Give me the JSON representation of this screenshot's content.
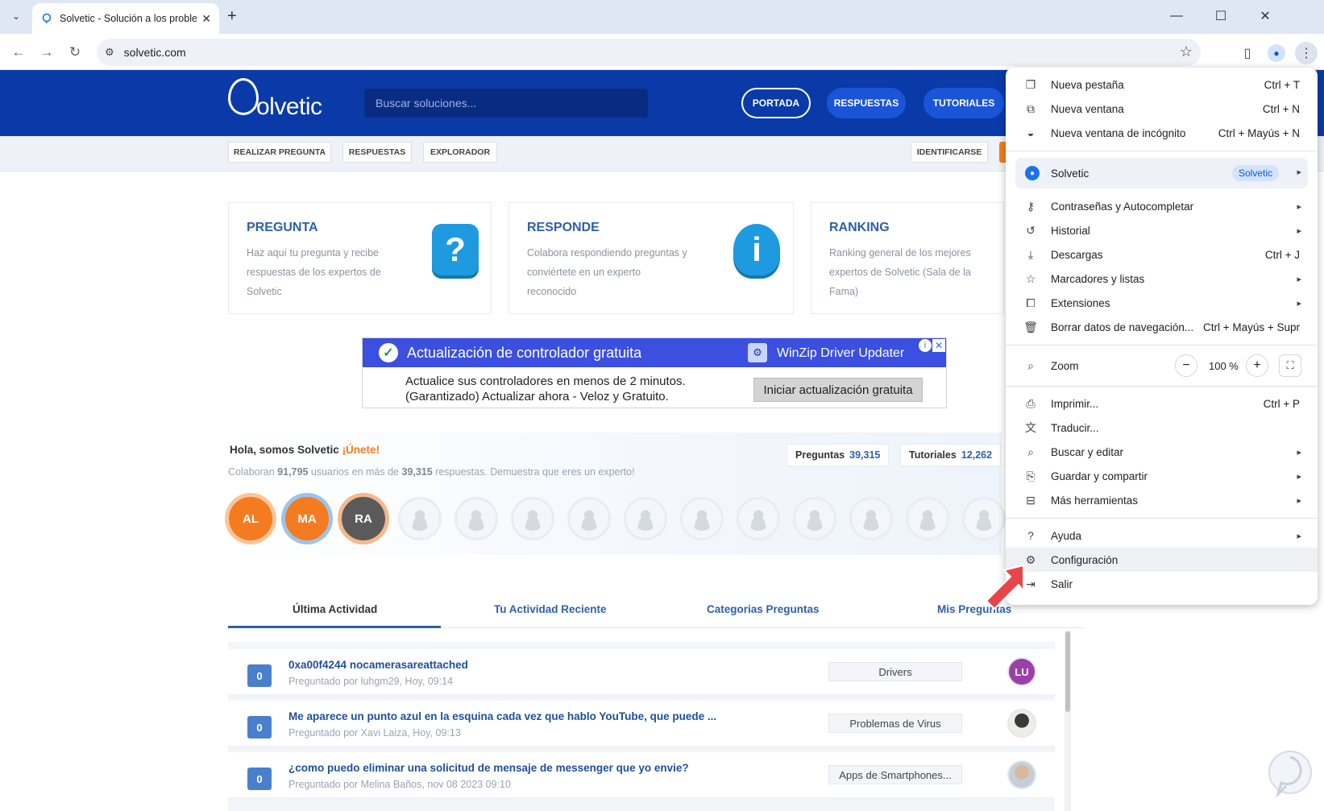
{
  "browser": {
    "tab_title": "Solvetic - Solución a los problemas",
    "url": "solvetic.com",
    "new_tab_symbol": "+",
    "window_controls": [
      "—",
      "☐",
      "✕"
    ]
  },
  "site": {
    "logo_text": "olvetic",
    "search_placeholder": "Buscar soluciones...",
    "nav": [
      "PORTADA",
      "RESPUESTAS",
      "TUTORIALES"
    ],
    "subnav": [
      "REALIZAR PREGUNTA",
      "RESPUESTAS",
      "EXPLORADOR"
    ],
    "login": "IDENTIFICARSE"
  },
  "cards": [
    {
      "title": "PREGUNTA",
      "desc": "Haz aquí tu pregunta y recibe respuestas de los expertos de Solvetic",
      "icon": "?"
    },
    {
      "title": "RESPONDE",
      "desc": "Colabora respondiendo preguntas y conviértete en un experto reconocido",
      "icon": "i"
    },
    {
      "title": "RANKING",
      "desc": "Ranking general de los mejores expertos de Solvetic (Sala de la Fama)",
      "icon": ""
    }
  ],
  "ad": {
    "headline": "Actualización de controlador gratuita",
    "brand": "WinZip Driver Updater",
    "body_line1": "Actualice sus controladores en menos de 2 minutos.",
    "body_line2": "(Garantizado) Actualizar ahora - Veloz y Gratuito.",
    "cta": "Iniciar actualización gratuita",
    "check_glyph": "✓",
    "winzip_glyph": "⚙",
    "info_glyph": "i",
    "close_glyph": "✕"
  },
  "community": {
    "greeting": "Hola, somos Solvetic",
    "join": "¡Únete!",
    "sub_prefix": "Colaboran",
    "sub_users": "91,795",
    "sub_mid": "usuarios en más de",
    "sub_answers": "39,315",
    "sub_suffix": "respuestas. Demuestra que eres un experto!",
    "stats": [
      {
        "label": "Preguntas",
        "value": "39,315"
      },
      {
        "label": "Tutoriales",
        "value": "12,262"
      }
    ],
    "avatars": [
      "AL",
      "MA",
      "RA"
    ]
  },
  "activity": {
    "tabs": [
      "Última Actividad",
      "Tu Actividad Reciente",
      "Categorias Preguntas",
      "Mis Preguntas"
    ],
    "questions": [
      {
        "count": "0",
        "title": "0xa00f4244 nocamerasareattached",
        "meta": "Preguntado por luhgm29, Hoy, 09:14",
        "category": "Drivers",
        "avatar": "LU"
      },
      {
        "count": "0",
        "title": "Me aparece un punto azul en la esquina cada vez que hablo YouTube, que puede ...",
        "meta": "Preguntado por Xavi Laiza, Hoy, 09:13",
        "category": "Problemas de Virus",
        "avatar": ""
      },
      {
        "count": "0",
        "title": "¿como puedo eliminar una solicitud de mensaje de messenger que yo envie?",
        "meta": "Preguntado por Melina Baños, nov 08 2023 09:10",
        "category": "Apps de Smartphones...",
        "avatar": ""
      }
    ]
  },
  "menu": {
    "items_top": [
      {
        "icon": "new-tab",
        "label": "Nueva pestaña",
        "shortcut": "Ctrl + T"
      },
      {
        "icon": "new-window",
        "label": "Nueva ventana",
        "shortcut": "Ctrl + N"
      },
      {
        "icon": "incognito",
        "label": "Nueva ventana de incógnito",
        "shortcut": "Ctrl + Mayús + N"
      }
    ],
    "profile": {
      "name": "Solvetic",
      "badge": "Solvetic"
    },
    "items_mid": [
      {
        "icon": "key",
        "label": "Contraseñas y Autocompletar",
        "shortcut": "",
        "arrow": true
      },
      {
        "icon": "history",
        "label": "Historial",
        "shortcut": "",
        "arrow": true
      },
      {
        "icon": "download",
        "label": "Descargas",
        "shortcut": "Ctrl + J",
        "arrow": false
      },
      {
        "icon": "star",
        "label": "Marcadores y listas",
        "shortcut": "",
        "arrow": true
      },
      {
        "icon": "puzzle",
        "label": "Extensiones",
        "shortcut": "",
        "arrow": true
      },
      {
        "icon": "trash",
        "label": "Borrar datos de navegación...",
        "shortcut": "Ctrl + Mayús + Supr",
        "arrow": false
      }
    ],
    "zoom": {
      "label": "Zoom",
      "value": "100 %",
      "minus": "−",
      "plus": "+"
    },
    "items_tools": [
      {
        "icon": "printer",
        "label": "Imprimir...",
        "shortcut": "Ctrl + P",
        "arrow": false
      },
      {
        "icon": "translate",
        "label": "Traducir...",
        "shortcut": "",
        "arrow": false
      },
      {
        "icon": "find",
        "label": "Buscar y editar",
        "shortcut": "",
        "arrow": true
      },
      {
        "icon": "save-share",
        "label": "Guardar y compartir",
        "shortcut": "",
        "arrow": true
      },
      {
        "icon": "toolbox",
        "label": "Más herramientas",
        "shortcut": "",
        "arrow": true
      }
    ],
    "items_bottom": [
      {
        "icon": "help",
        "label": "Ayuda",
        "shortcut": "",
        "arrow": true
      },
      {
        "icon": "gear",
        "label": "Configuración",
        "shortcut": "",
        "arrow": false
      },
      {
        "icon": "exit",
        "label": "Salir",
        "shortcut": "",
        "arrow": false
      }
    ]
  },
  "colors": {
    "brand_blue": "#0a3aa8",
    "link_blue": "#2f5fa8",
    "accent_orange": "#f47b20",
    "ad_blue": "#3b4fe0",
    "arrow_red": "#e8454a"
  }
}
